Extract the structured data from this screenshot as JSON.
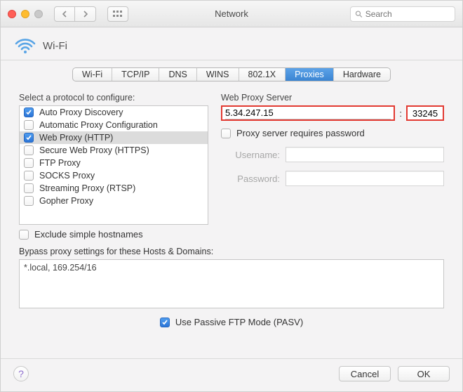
{
  "titlebar": {
    "title": "Network",
    "search_placeholder": "Search"
  },
  "header": {
    "interface": "Wi-Fi"
  },
  "tabs": [
    "Wi-Fi",
    "TCP/IP",
    "DNS",
    "WINS",
    "802.1X",
    "Proxies",
    "Hardware"
  ],
  "tabs_active_index": 5,
  "left": {
    "label": "Select a protocol to configure:",
    "items": [
      {
        "label": "Auto Proxy Discovery",
        "checked": true,
        "selected": false
      },
      {
        "label": "Automatic Proxy Configuration",
        "checked": false,
        "selected": false
      },
      {
        "label": "Web Proxy (HTTP)",
        "checked": true,
        "selected": true
      },
      {
        "label": "Secure Web Proxy (HTTPS)",
        "checked": false,
        "selected": false
      },
      {
        "label": "FTP Proxy",
        "checked": false,
        "selected": false
      },
      {
        "label": "SOCKS Proxy",
        "checked": false,
        "selected": false
      },
      {
        "label": "Streaming Proxy (RTSP)",
        "checked": false,
        "selected": false
      },
      {
        "label": "Gopher Proxy",
        "checked": false,
        "selected": false
      }
    ],
    "exclude_label": "Exclude simple hostnames",
    "exclude_checked": false
  },
  "right": {
    "title": "Web Proxy Server",
    "host": "5.34.247.15",
    "port_sep": ":",
    "port": "33245",
    "requires_pw_label": "Proxy server requires password",
    "requires_pw_checked": false,
    "username_label": "Username:",
    "username_value": "",
    "password_label": "Password:",
    "password_value": ""
  },
  "bypass": {
    "label": "Bypass proxy settings for these Hosts & Domains:",
    "value": "*.local, 169.254/16"
  },
  "pasv": {
    "label": "Use Passive FTP Mode (PASV)",
    "checked": true
  },
  "footer": {
    "cancel": "Cancel",
    "ok": "OK"
  }
}
